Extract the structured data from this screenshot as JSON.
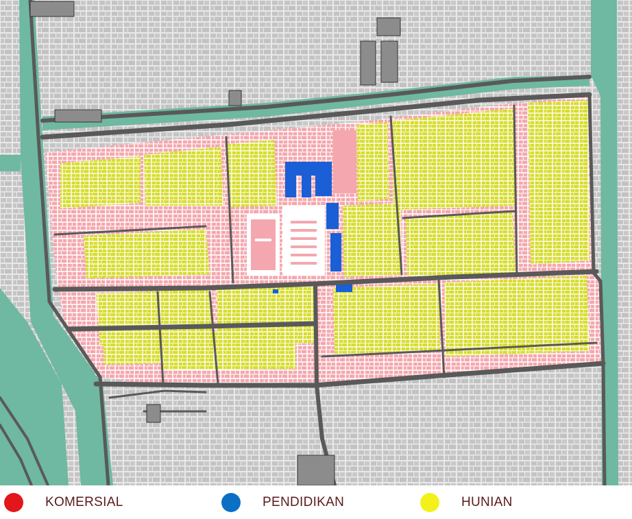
{
  "colors": {
    "background": "#d9d9d9",
    "building_gray": "#bfbfbf",
    "road": "#595959",
    "water": "#6fb8a1",
    "komersial_fill": "#f4a7ae",
    "hunian_fill": "#d7dd2d",
    "pendidikan_fill": "#1a5fd6"
  },
  "legend": {
    "items": [
      {
        "label": "KOMERSIAL",
        "color": "#e3161c"
      },
      {
        "label": "PENDIDIKAN",
        "color": "#0b6fc4"
      },
      {
        "label": "HUNIAN",
        "color": "#f2f21a"
      }
    ]
  }
}
